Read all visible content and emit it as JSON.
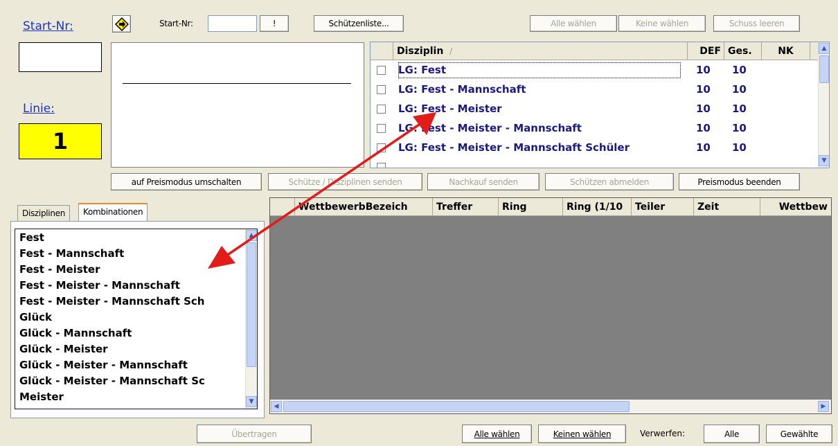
{
  "top": {
    "startnr_link": "Start-Nr:",
    "startnr_label": "Start-Nr:",
    "bang_label": "!",
    "schuetzenliste": "Schützenliste...",
    "alle_waehlen": "Alle wählen",
    "keine_waehlen": "Keine wählen",
    "schuss_leeren": "Schuss leeren",
    "linie_link": "Linie:",
    "linie_value": "1"
  },
  "discipline_table": {
    "headers": [
      "Disziplin",
      "DEF",
      "Ges.",
      "NK"
    ],
    "sort_indicator": "/",
    "rows": [
      {
        "name": "LG: Fest",
        "def": "10",
        "ges": "10"
      },
      {
        "name": "LG: Fest - Mannschaft",
        "def": "10",
        "ges": "10"
      },
      {
        "name": "LG: Fest - Meister",
        "def": "10",
        "ges": "10"
      },
      {
        "name": "LG: Fest - Meister - Mannschaft",
        "def": "10",
        "ges": "10"
      },
      {
        "name": "LG: Fest - Meister - Mannschaft Schüler",
        "def": "10",
        "ges": "10"
      }
    ]
  },
  "mid_buttons": {
    "preismodus_umschalten": "auf Preismodus umschalten",
    "schuetze_senden": "Schütze / Disziplinen senden",
    "nachkauf_senden": "Nachkauf senden",
    "schuetzen_abmelden": "Schützen abmelden",
    "preismodus_beenden": "Preismodus beenden"
  },
  "tabs": [
    "Disziplinen",
    "Kombinationen"
  ],
  "combinations": [
    "Fest",
    "Fest - Mannschaft",
    "Fest - Meister",
    "Fest - Meister - Mannschaft",
    "Fest - Meister - Mannschaft Sch",
    "Glück",
    "Glück - Mannschaft",
    "Glück - Meister",
    "Glück - Meister - Mannschaft",
    "Glück - Meister - Mannschaft Sc",
    "Meister"
  ],
  "results_grid": {
    "headers": [
      "WettbewerbBezeich",
      "Treffer",
      "Ring",
      "Ring (1/10",
      "Teiler",
      "Zeit",
      "Wettbew"
    ]
  },
  "bottom": {
    "uebertragen": "Übertragen",
    "alle_waehlen": "Alle wählen",
    "keinen_waehlen": "Keinen wählen",
    "verwerfen_label": "Verwerfen:",
    "alle": "Alle",
    "gewaehlte": "Gewählte"
  },
  "colors": {
    "window_bg": "#ece9d8",
    "link_blue": "#1a33cc",
    "row_text": "#1a1a80",
    "linie_bg": "#ffff00",
    "grid_bg": "#808080",
    "arrow": "#e21b1b"
  }
}
